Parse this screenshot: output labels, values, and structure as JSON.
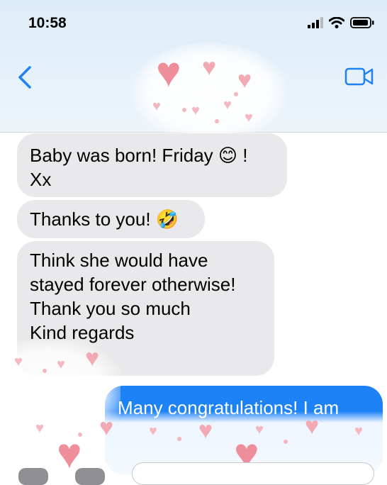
{
  "status_bar": {
    "time": "10:58"
  },
  "nav": {
    "back_icon": "chevron-left-icon",
    "video_icon": "video-camera-icon",
    "accent": "#1d82f6"
  },
  "messages": [
    {
      "direction": "incoming",
      "lines": [
        "Baby was born! Friday 😊 !",
        "Xx"
      ]
    },
    {
      "direction": "incoming",
      "lines": [
        "Thanks to you! 🤣"
      ]
    },
    {
      "direction": "incoming",
      "lines": [
        "Think she would have",
        "stayed forever otherwise!",
        "Thank you so much",
        "Kind regards"
      ]
    },
    {
      "direction": "outgoing",
      "lines": [
        "Many congratulations! I am"
      ]
    }
  ],
  "colors": {
    "incoming_bubble": "#e9e9eb",
    "outgoing_bubble": "#1d82f6",
    "hearts": "#ef8e9b"
  }
}
